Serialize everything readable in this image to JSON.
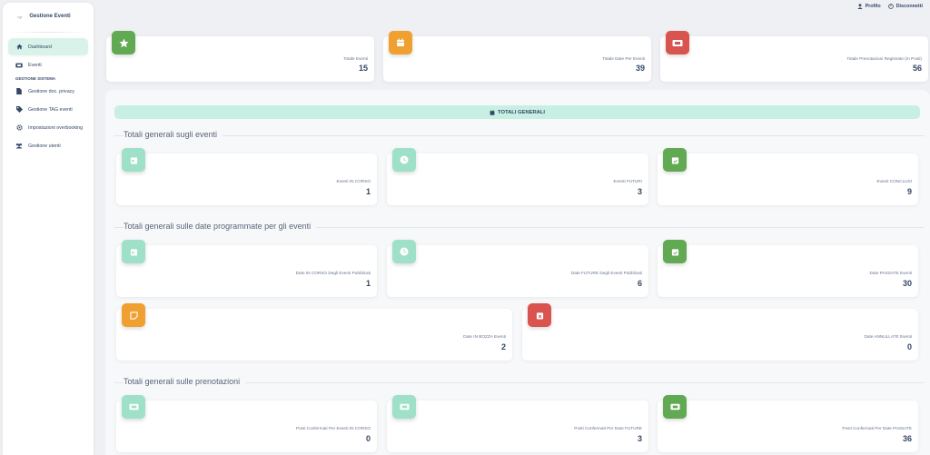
{
  "app": {
    "brand_logo": "cgt",
    "brand_name": "Gestione Eventi"
  },
  "sidebar": {
    "items": [
      {
        "label": "Dashboard",
        "icon": "home-icon"
      },
      {
        "label": "Eventi",
        "icon": "ticket-icon"
      }
    ],
    "section_label": "GESTIONE SISTEMA",
    "system_items": [
      {
        "label": "Gestione doc. privacy",
        "icon": "document-icon"
      },
      {
        "label": "Gestione TAG eventi",
        "icon": "tag-icon"
      },
      {
        "label": "Impostazioni overbooking",
        "icon": "gear-icon"
      },
      {
        "label": "Gestione utenti",
        "icon": "users-icon"
      }
    ]
  },
  "topbar": {
    "profile": "Profilo",
    "logout": "Disconnetti"
  },
  "top_cards": [
    {
      "label": "Totale Eventi",
      "value": "15",
      "color": "#62a954",
      "icon": "star-icon"
    },
    {
      "label": "Totale Date Per Eventi",
      "value": "39",
      "color": "#f0a030",
      "icon": "calendar-icon"
    },
    {
      "label": "Totale Prenotazioni Registrate (In Posti)",
      "value": "56",
      "color": "#d9534f",
      "icon": "ticket-icon"
    }
  ],
  "totali_bar": {
    "label": "TOTALI GENERALI"
  },
  "sections": {
    "eventi": {
      "title": "Totali generali sugli eventi",
      "cards": [
        {
          "label": "Eventi IN CORSO",
          "value": "1"
        },
        {
          "label": "Eventi FUTURI",
          "value": "3"
        },
        {
          "label": "Eventi CONCLUSI",
          "value": "9"
        }
      ]
    },
    "date": {
      "title": "Totali generali sulle date programmate per gli eventi",
      "cards": [
        {
          "label": "Date IN CORSO Degli Eventi Pubblicati",
          "value": "1"
        },
        {
          "label": "Date FUTURE Degli Eventi Pubblicati",
          "value": "6"
        },
        {
          "label": "Date PASSATE Eventi",
          "value": "30"
        },
        {
          "label": "Date IN BOZZA Eventi",
          "value": "2"
        },
        {
          "label": "Date ANNULLATE Eventi",
          "value": "0"
        }
      ]
    },
    "prenotazioni": {
      "title": "Totali generali sulle prenotazioni",
      "cards": [
        {
          "label": "Posti Confermati Per Eventi IN CORSO",
          "value": "0"
        },
        {
          "label": "Posti Confermati Per Date FUTURE",
          "value": "3"
        },
        {
          "label": "Posti Confermati Per Date PASSATE",
          "value": "36"
        }
      ]
    }
  },
  "colors": {
    "teal": "#9fe0c9",
    "green": "#62a954",
    "orange": "#f0a030",
    "red": "#d9534f",
    "accent_bg": "#d9f3ea"
  }
}
